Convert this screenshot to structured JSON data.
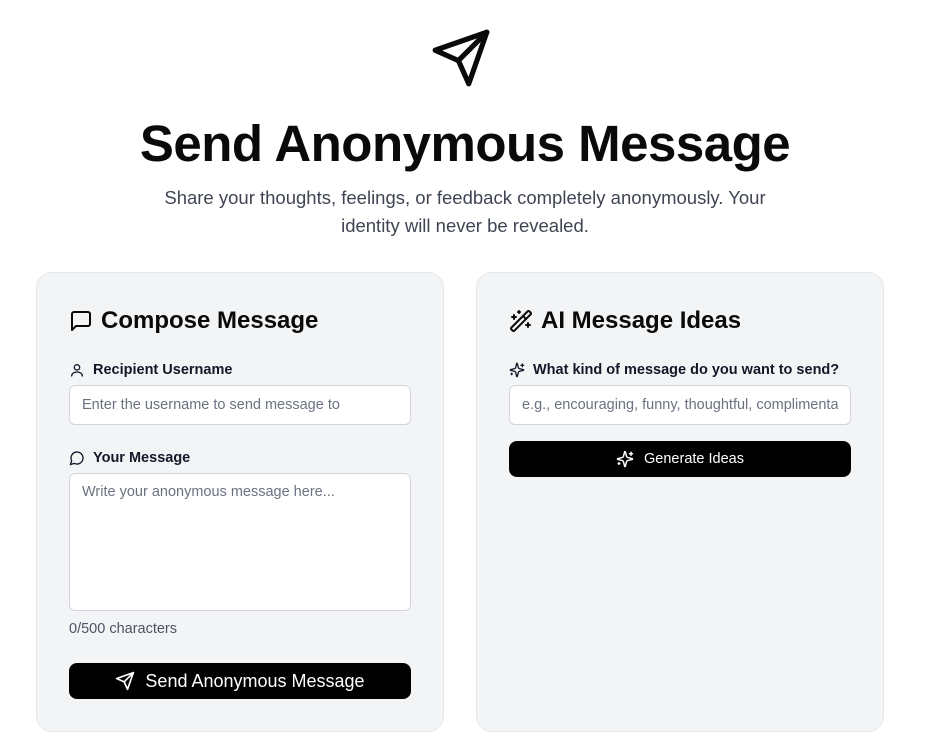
{
  "hero": {
    "icon": "send-icon",
    "title": "Send Anonymous Message",
    "subtitle": "Share your thoughts, feelings, or feedback completely anonymously. Your identity will never be revealed."
  },
  "compose": {
    "title": "Compose Message",
    "title_icon": "message-square-icon",
    "recipient_label": "Recipient Username",
    "recipient_icon": "user-icon",
    "recipient_placeholder": "Enter the username to send message to",
    "recipient_value": "",
    "message_label": "Your Message",
    "message_icon": "message-circle-icon",
    "message_placeholder": "Write your anonymous message here...",
    "message_value": "",
    "char_count": "0/500 characters",
    "send_button": "Send Anonymous Message",
    "send_button_icon": "send-icon"
  },
  "ai": {
    "title": "AI Message Ideas",
    "title_icon": "wand-sparkles-icon",
    "prompt_label": "What kind of message do you want to send?",
    "prompt_icon": "sparkles-icon",
    "prompt_placeholder": "e.g., encouraging, funny, thoughtful, complimentary",
    "prompt_value": "",
    "generate_button": "Generate Ideas",
    "generate_button_icon": "sparkles-icon"
  },
  "colors": {
    "card_background": "#f3f4f6",
    "button_background": "#000000",
    "button_text": "#ffffff",
    "subtitle_text": "#404553"
  }
}
